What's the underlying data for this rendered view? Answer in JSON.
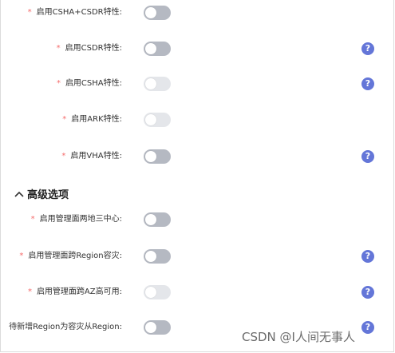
{
  "settings": [
    {
      "label": "启用CSHA+CSDR特性:",
      "required": true,
      "enabled": true,
      "help": false
    },
    {
      "label": "启用CSDR特性:",
      "required": true,
      "enabled": true,
      "help": true
    },
    {
      "label": "启用CSHA特性:",
      "required": true,
      "enabled": false,
      "help": true
    },
    {
      "label": "启用ARK特性:",
      "required": true,
      "enabled": false,
      "help": false
    },
    {
      "label": "启用VHA特性:",
      "required": true,
      "enabled": true,
      "help": true
    }
  ],
  "advanced": {
    "title": "高级选项",
    "chevron_icon": "chevron-up-icon",
    "items": [
      {
        "label": "启用管理面两地三中心:",
        "required": true,
        "enabled": true,
        "help": false
      },
      {
        "label": "启用管理面跨Region容灾:",
        "required": true,
        "enabled": true,
        "help": true
      },
      {
        "label": "启用管理面跨AZ高可用:",
        "required": true,
        "enabled": false,
        "help": true
      },
      {
        "label": "待新增Region为容灾从Region:",
        "required": false,
        "enabled": true,
        "help": true
      }
    ]
  },
  "required_marker": "*",
  "help_symbol": "?",
  "colors": {
    "accent": "#6476d8",
    "required": "#f56c6c",
    "switch_off": "#b5b9c2",
    "switch_disabled": "#e4e6ea"
  },
  "watermark": "CSDN @I人间无事人"
}
